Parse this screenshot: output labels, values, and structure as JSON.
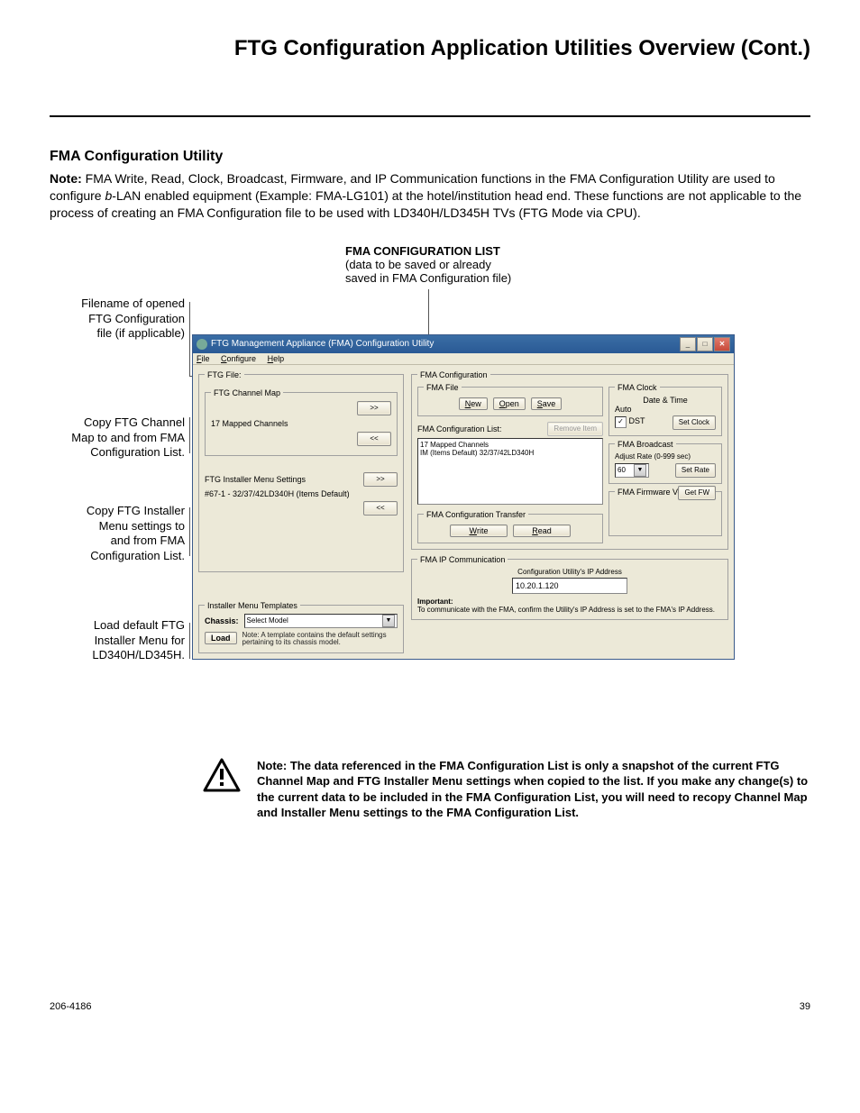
{
  "page": {
    "title": "FTG Configuration Application Utilities Overview (Cont.)",
    "doc_id": "206-4186",
    "page_no": "39"
  },
  "section": {
    "heading": "FMA Configuration Utility",
    "note_prefix": "Note: ",
    "note_body_1": "FMA Write, Read, Clock, Broadcast, Firmware, and IP Communication functions in the FMA Configuration Utility are used to configure ",
    "note_italic": "b",
    "note_body_2": "-LAN enabled equipment (Example: FMA-LG101) at the hotel/institution head end. These functions are not applicable to the process of creating an FMA Configuration file to be used with LD340H/LD345H TVs (FTG Mode via CPU)."
  },
  "callouts": {
    "config_list_title": "FMA CONFIGURATION LIST",
    "config_list_sub1": "(data to be saved or already",
    "config_list_sub2": "saved in FMA Configuration file)",
    "filename": "Filename of opened FTG Configuration file (if applicable)",
    "copy_channel": "Copy FTG Channel Map to and from FMA Configuration List.",
    "copy_installer": "Copy FTG Installer Menu settings to and from FMA Configuration List.",
    "load_default": "Load default FTG Installer Menu for LD340H/LD345H."
  },
  "app": {
    "title": "FTG Management Appliance (FMA) Configuration Utility",
    "menus": {
      "file": "File",
      "configure": "Configure",
      "help": "Help"
    },
    "ftg_file": {
      "legend": "FTG File:",
      "channel_map": {
        "legend": "FTG Channel Map",
        "count": "17 Mapped Channels",
        "btn_right": ">>",
        "btn_left": "<<"
      },
      "installer": {
        "label": "FTG Installer Menu Settings",
        "item": "#67-1 - 32/37/42LD340H (Items Default)",
        "btn_right": ">>",
        "btn_left": "<<"
      }
    },
    "templates": {
      "legend": "Installer Menu Templates",
      "chassis_label": "Chassis:",
      "chassis_value": "Select Model",
      "load": "Load",
      "note": "Note: A template contains the default settings pertaining to its chassis model."
    },
    "fma_config": {
      "legend": "FMA Configuration",
      "file_legend": "FMA File",
      "new": "New",
      "open": "Open",
      "save": "Save",
      "list_label": "FMA Configuration List:",
      "remove": "Remove Item",
      "list_item1": "17 Mapped Channels",
      "list_item2": "IM (Items Default) 32/37/42LD340H",
      "transfer_legend": "FMA Configuration Transfer",
      "write": "Write",
      "read": "Read"
    },
    "clock": {
      "legend": "FMA Clock",
      "dt": "Date & Time",
      "auto": "Auto",
      "dst": "DST",
      "set_clock": "Set Clock"
    },
    "broadcast": {
      "legend": "FMA Broadcast",
      "rate_label": "Adjust Rate (0-999 sec)",
      "rate_value": "60",
      "set_rate": "Set Rate"
    },
    "firmware": {
      "legend": "FMA Firmware Version",
      "get_fw": "Get FW"
    },
    "ip": {
      "legend": "FMA IP Communication",
      "ip_label": "Configuration Utility's IP Address",
      "ip_value": "10.20.1.120",
      "important_label": "Important:",
      "important_text": "To communicate with the FMA, confirm the Utility's IP Address is set to the FMA's IP Address."
    }
  },
  "warning": {
    "text": "Note: The data referenced in the FMA Configuration List is only a snapshot of the current FTG Channel Map and FTG Installer Menu settings when copied to the list. If you make any change(s) to the current data to be included in the FMA Configuration List, you will need to recopy Channel Map and Installer Menu settings to the FMA Configuration List."
  }
}
